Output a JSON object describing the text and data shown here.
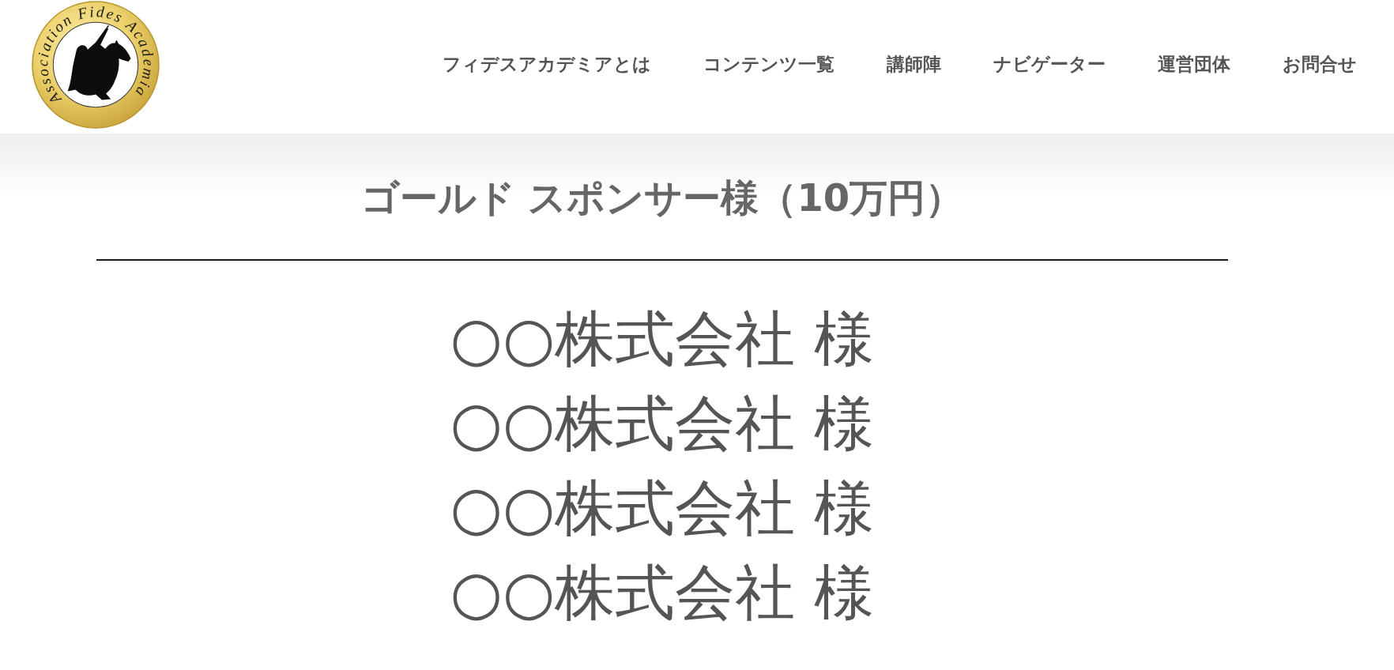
{
  "header": {
    "logo": {
      "text": "Association Fides Academia"
    },
    "nav": [
      "フィデスアカデミアとは",
      "コンテンツ一覧",
      "講師陣",
      "ナビゲーター",
      "運営団体",
      "お問合せ"
    ]
  },
  "section": {
    "title": "ゴールド スポンサー様（10万円）",
    "sponsors": [
      "○○株式会社 様",
      "○○株式会社 様",
      "○○株式会社 様",
      "○○株式会社 様"
    ]
  }
}
